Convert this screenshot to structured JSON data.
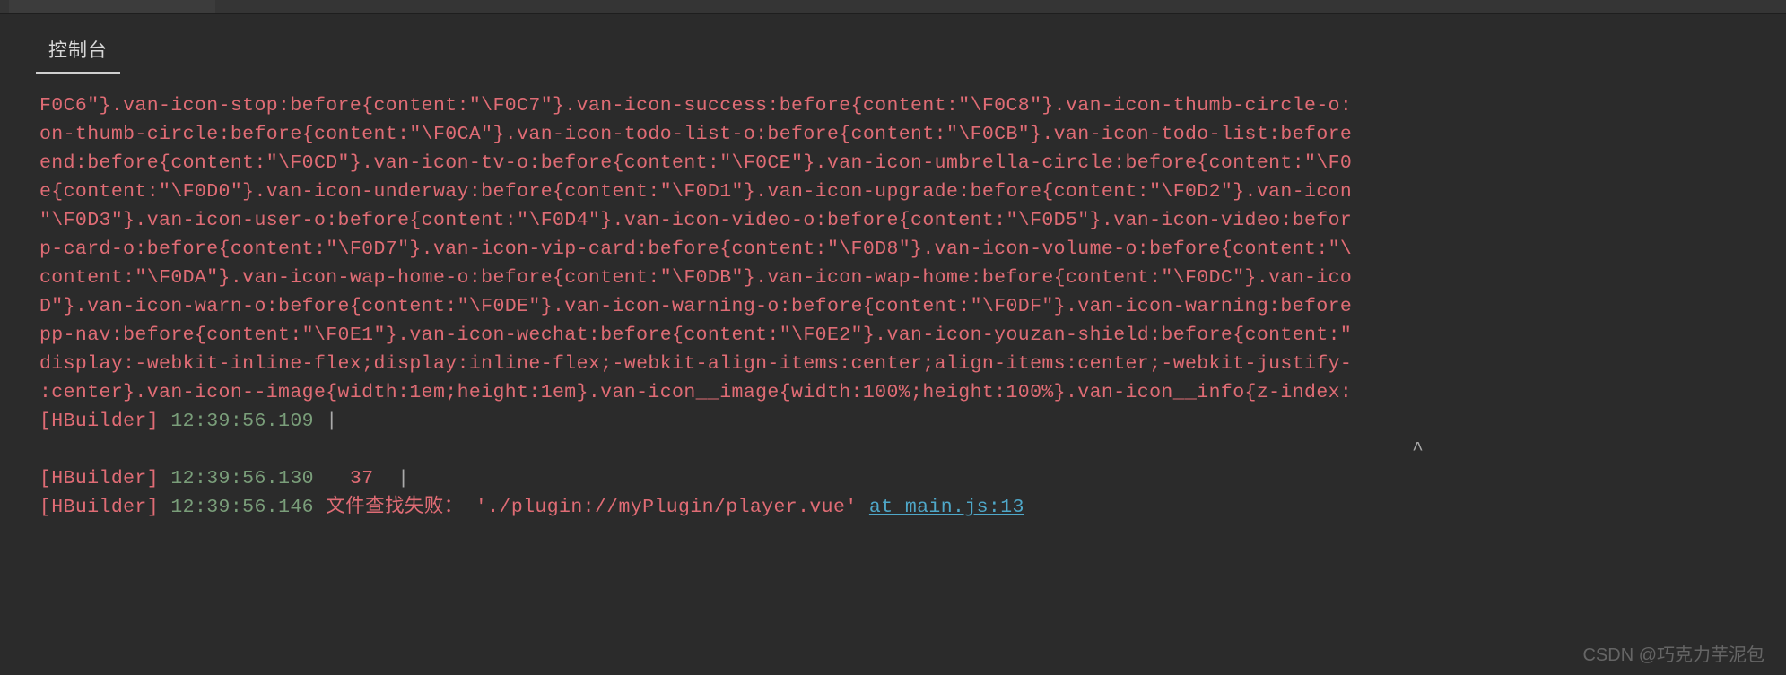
{
  "tab": {
    "label": "控制台"
  },
  "css_lines": [
    "F0C6\"}.van-icon-stop:before{content:\"\\F0C7\"}.van-icon-success:before{content:\"\\F0C8\"}.van-icon-thumb-circle-o:",
    "on-thumb-circle:before{content:\"\\F0CA\"}.van-icon-todo-list-o:before{content:\"\\F0CB\"}.van-icon-todo-list:before",
    "end:before{content:\"\\F0CD\"}.van-icon-tv-o:before{content:\"\\F0CE\"}.van-icon-umbrella-circle:before{content:\"\\F0",
    "e{content:\"\\F0D0\"}.van-icon-underway:before{content:\"\\F0D1\"}.van-icon-upgrade:before{content:\"\\F0D2\"}.van-icon",
    "\"\\F0D3\"}.van-icon-user-o:before{content:\"\\F0D4\"}.van-icon-video-o:before{content:\"\\F0D5\"}.van-icon-video:befor",
    "p-card-o:before{content:\"\\F0D7\"}.van-icon-vip-card:before{content:\"\\F0D8\"}.van-icon-volume-o:before{content:\"\\",
    "content:\"\\F0DA\"}.van-icon-wap-home-o:before{content:\"\\F0DB\"}.van-icon-wap-home:before{content:\"\\F0DC\"}.van-ico",
    "D\"}.van-icon-warn-o:before{content:\"\\F0DE\"}.van-icon-warning-o:before{content:\"\\F0DF\"}.van-icon-warning:before",
    "pp-nav:before{content:\"\\F0E1\"}.van-icon-wechat:before{content:\"\\F0E2\"}.van-icon-youzan-shield:before{content:\"",
    "display:-webkit-inline-flex;display:inline-flex;-webkit-align-items:center;align-items:center;-webkit-justify-",
    ":center}.van-icon--image{width:1em;height:1em}.van-icon__image{width:100%;height:100%}.van-icon__info{z-index:"
  ],
  "logs": {
    "l1": {
      "tag": "[HBuilder]",
      "time": "12:39:56.109",
      "sep": "     |"
    },
    "caret": "^",
    "l2": {
      "tag": "[HBuilder]",
      "time": "12:39:56.130",
      "num": "37",
      "sep": "|"
    },
    "l3": {
      "tag": "[HBuilder]",
      "time": "12:39:56.146",
      "msg": "文件查找失败：",
      "path": "'./plugin://myPlugin/player.vue'",
      "link": "at main.js:13"
    }
  },
  "watermark": "CSDN @巧克力芋泥包"
}
